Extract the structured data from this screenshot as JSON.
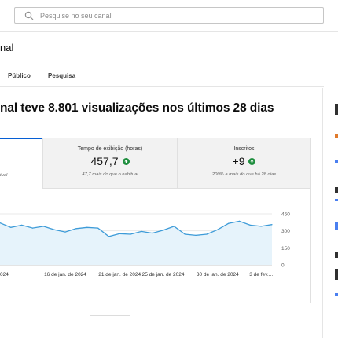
{
  "search": {
    "placeholder": "Pesquise no seu canal"
  },
  "channel": {
    "title_fragment": "nal"
  },
  "tabs": [
    {
      "label": "Público"
    },
    {
      "label": "Pesquisa"
    }
  ],
  "headline": "nal teve 8.801 visualizações nos últimos 28 dias",
  "metrics": [
    {
      "label": "",
      "value": "",
      "note": "tual"
    },
    {
      "label": "Tempo de exibição (horas)",
      "value": "457,7",
      "note": "47,7 mais do que o habitual",
      "trend_icon": "arrow-up-circle-icon"
    },
    {
      "label": "Inscritos",
      "value": "+9",
      "note": "200% a mais do que há 28 dias",
      "trend_icon": "arrow-up-circle-icon"
    }
  ],
  "colors": {
    "accent": "#065fd4",
    "trend_up": "#1e8e3e",
    "line": "#3d9bd8",
    "area": "#e6f3fb"
  },
  "chart_data": {
    "type": "area",
    "x": [
      "2024-01-10",
      "2024-01-11",
      "2024-01-12",
      "2024-01-13",
      "2024-01-14",
      "2024-01-15",
      "2024-01-16",
      "2024-01-17",
      "2024-01-18",
      "2024-01-19",
      "2024-01-20",
      "2024-01-21",
      "2024-01-22",
      "2024-01-23",
      "2024-01-24",
      "2024-01-25",
      "2024-01-26",
      "2024-01-27",
      "2024-01-28",
      "2024-01-29",
      "2024-01-30",
      "2024-01-31",
      "2024-02-01",
      "2024-02-02",
      "2024-02-03",
      "2024-02-04"
    ],
    "values": [
      370,
      330,
      350,
      325,
      340,
      310,
      290,
      320,
      330,
      325,
      250,
      275,
      270,
      295,
      280,
      305,
      340,
      270,
      260,
      270,
      310,
      365,
      385,
      350,
      340,
      355
    ],
    "x_tick_labels": [
      "024",
      "16 de jan. de 2024",
      "21 de jan. de 2024",
      "25 de jan. de 2024",
      "30 de jan. de 2024",
      "3 de fev...."
    ],
    "y_tick_labels": [
      "450",
      "300",
      "150",
      "0"
    ],
    "ylim": [
      0,
      450
    ],
    "grid": true
  },
  "right_panel_icons": [
    "panel-strip"
  ]
}
